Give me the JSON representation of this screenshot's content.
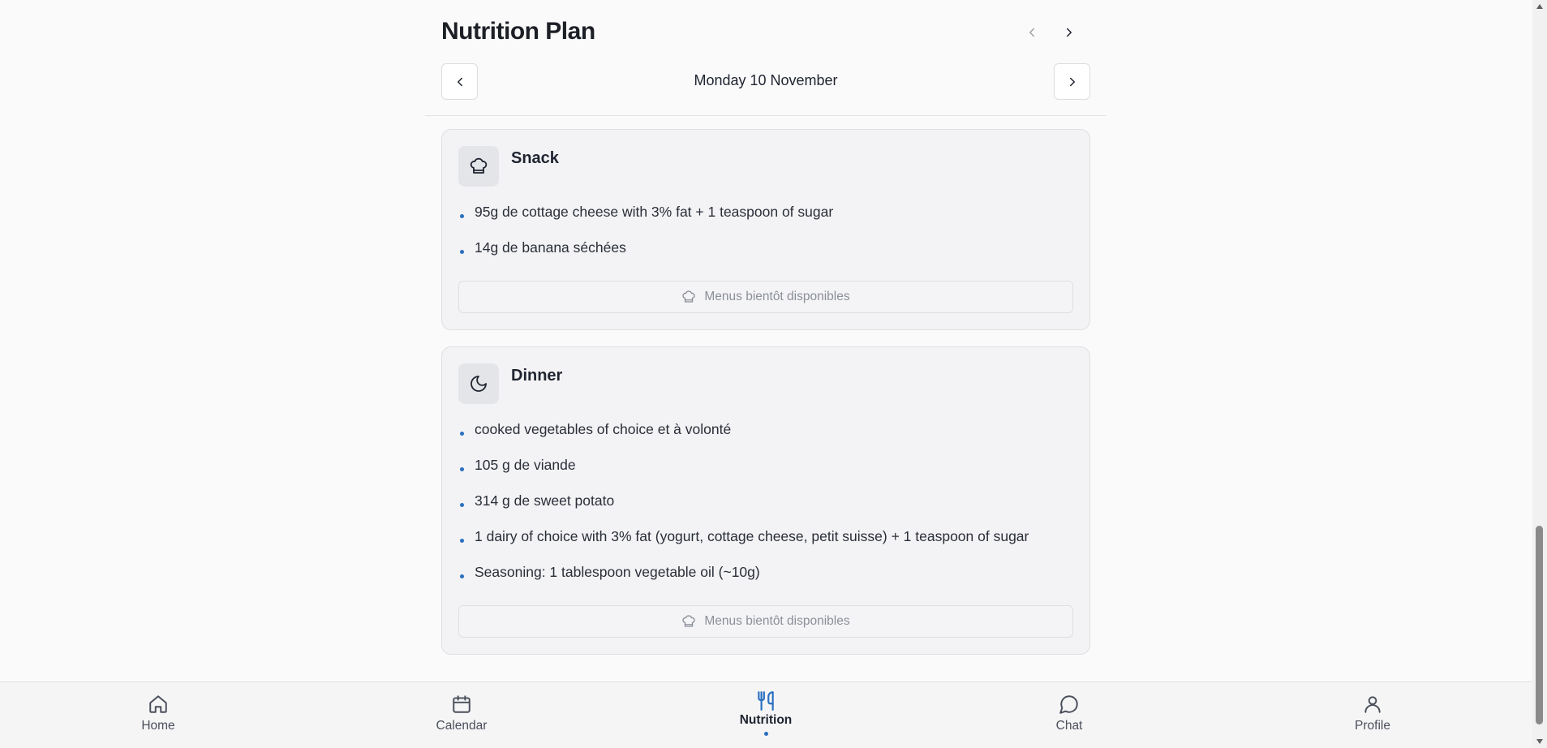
{
  "header": {
    "title": "Nutrition Plan",
    "date_label": "Monday 10 November"
  },
  "meals": [
    {
      "title": "Snack",
      "icon": "chef-hat-icon",
      "items": [
        "95g de cottage cheese with 3% fat + 1 teaspoon of sugar",
        "14g de banana séchées"
      ],
      "menus_label": "Menus bientôt disponibles"
    },
    {
      "title": "Dinner",
      "icon": "moon-icon",
      "items": [
        "cooked vegetables of choice et à volonté",
        "105 g de viande",
        "314 g de sweet potato",
        "1 dairy of choice with 3% fat (yogurt, cottage cheese, petit suisse) + 1 teaspoon of sugar",
        "Seasoning: 1 tablespoon vegetable oil (~10g)"
      ],
      "menus_label": "Menus bientôt disponibles"
    }
  ],
  "bottom_nav": {
    "items": [
      {
        "label": "Home",
        "icon": "home-icon"
      },
      {
        "label": "Calendar",
        "icon": "calendar-icon"
      },
      {
        "label": "Nutrition",
        "icon": "utensils-icon",
        "active": true
      },
      {
        "label": "Chat",
        "icon": "chat-bubble-icon"
      },
      {
        "label": "Profile",
        "icon": "user-icon"
      }
    ]
  },
  "colors": {
    "accent": "#2a6fc0",
    "background": "#fafafa",
    "card": "#f3f3f5",
    "text": "#1f2430",
    "muted": "#8b8f99"
  }
}
